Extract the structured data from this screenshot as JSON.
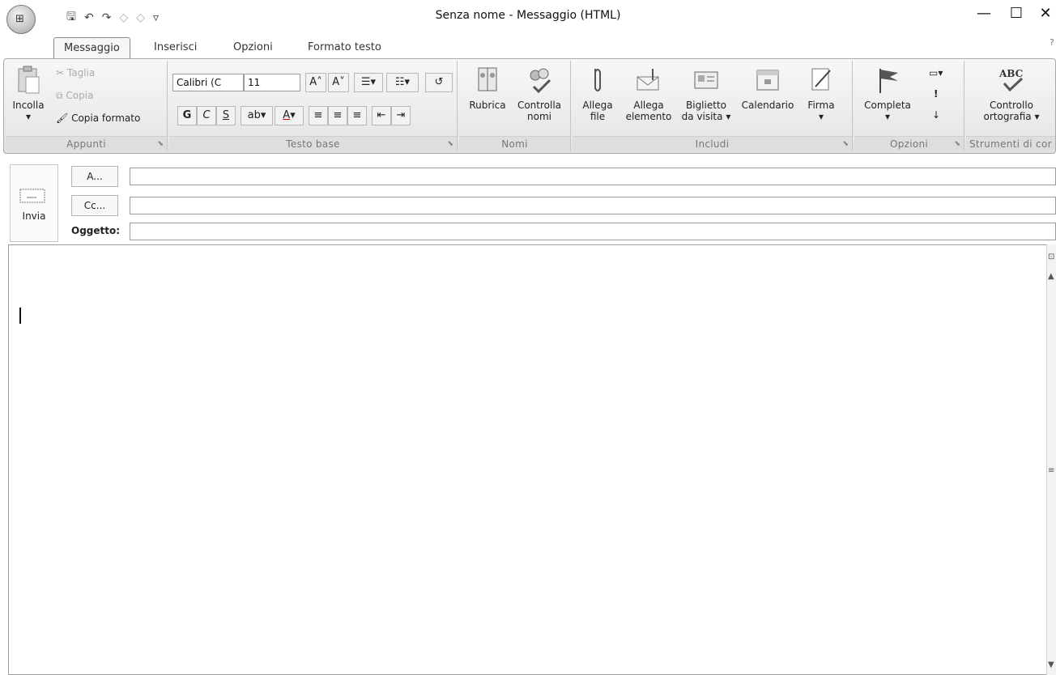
{
  "window": {
    "title": "Senza nome - Messaggio (HTML)",
    "minimize": "—",
    "maximize": "☐",
    "close": "✕"
  },
  "tabs": [
    "Messaggio",
    "Inserisci",
    "Opzioni",
    "Formato testo"
  ],
  "active_tab": "Messaggio",
  "clipboard": {
    "paste": "Incolla",
    "cut": "Taglia",
    "copy": "Copia",
    "format_painter": "Copia formato",
    "label": "Appunti"
  },
  "basic_text": {
    "font": "Calibri (C",
    "size": "11",
    "bold": "G",
    "italic": "C",
    "underline": "S",
    "label": "Testo base"
  },
  "names": {
    "address_book": "Rubrica",
    "check_names_1": "Controlla",
    "check_names_2": "nomi",
    "label": "Nomi"
  },
  "include": {
    "attach_file_1": "Allega",
    "attach_file_2": "file",
    "attach_item_1": "Allega",
    "attach_item_2": "elemento",
    "business_card_1": "Biglietto",
    "business_card_2": "da visita",
    "calendar": "Calendario",
    "signature": "Firma",
    "label": "Includi"
  },
  "options": {
    "follow_up": "Completa",
    "label": "Opzioni"
  },
  "proofing": {
    "spelling_1": "Controllo",
    "spelling_2": "ortografia",
    "label": "Strumenti di cor"
  },
  "header": {
    "send": "Invia",
    "to": "A...",
    "cc": "Cc...",
    "subject_label": "Oggetto:",
    "to_value": "",
    "cc_value": "",
    "subject_value": ""
  }
}
